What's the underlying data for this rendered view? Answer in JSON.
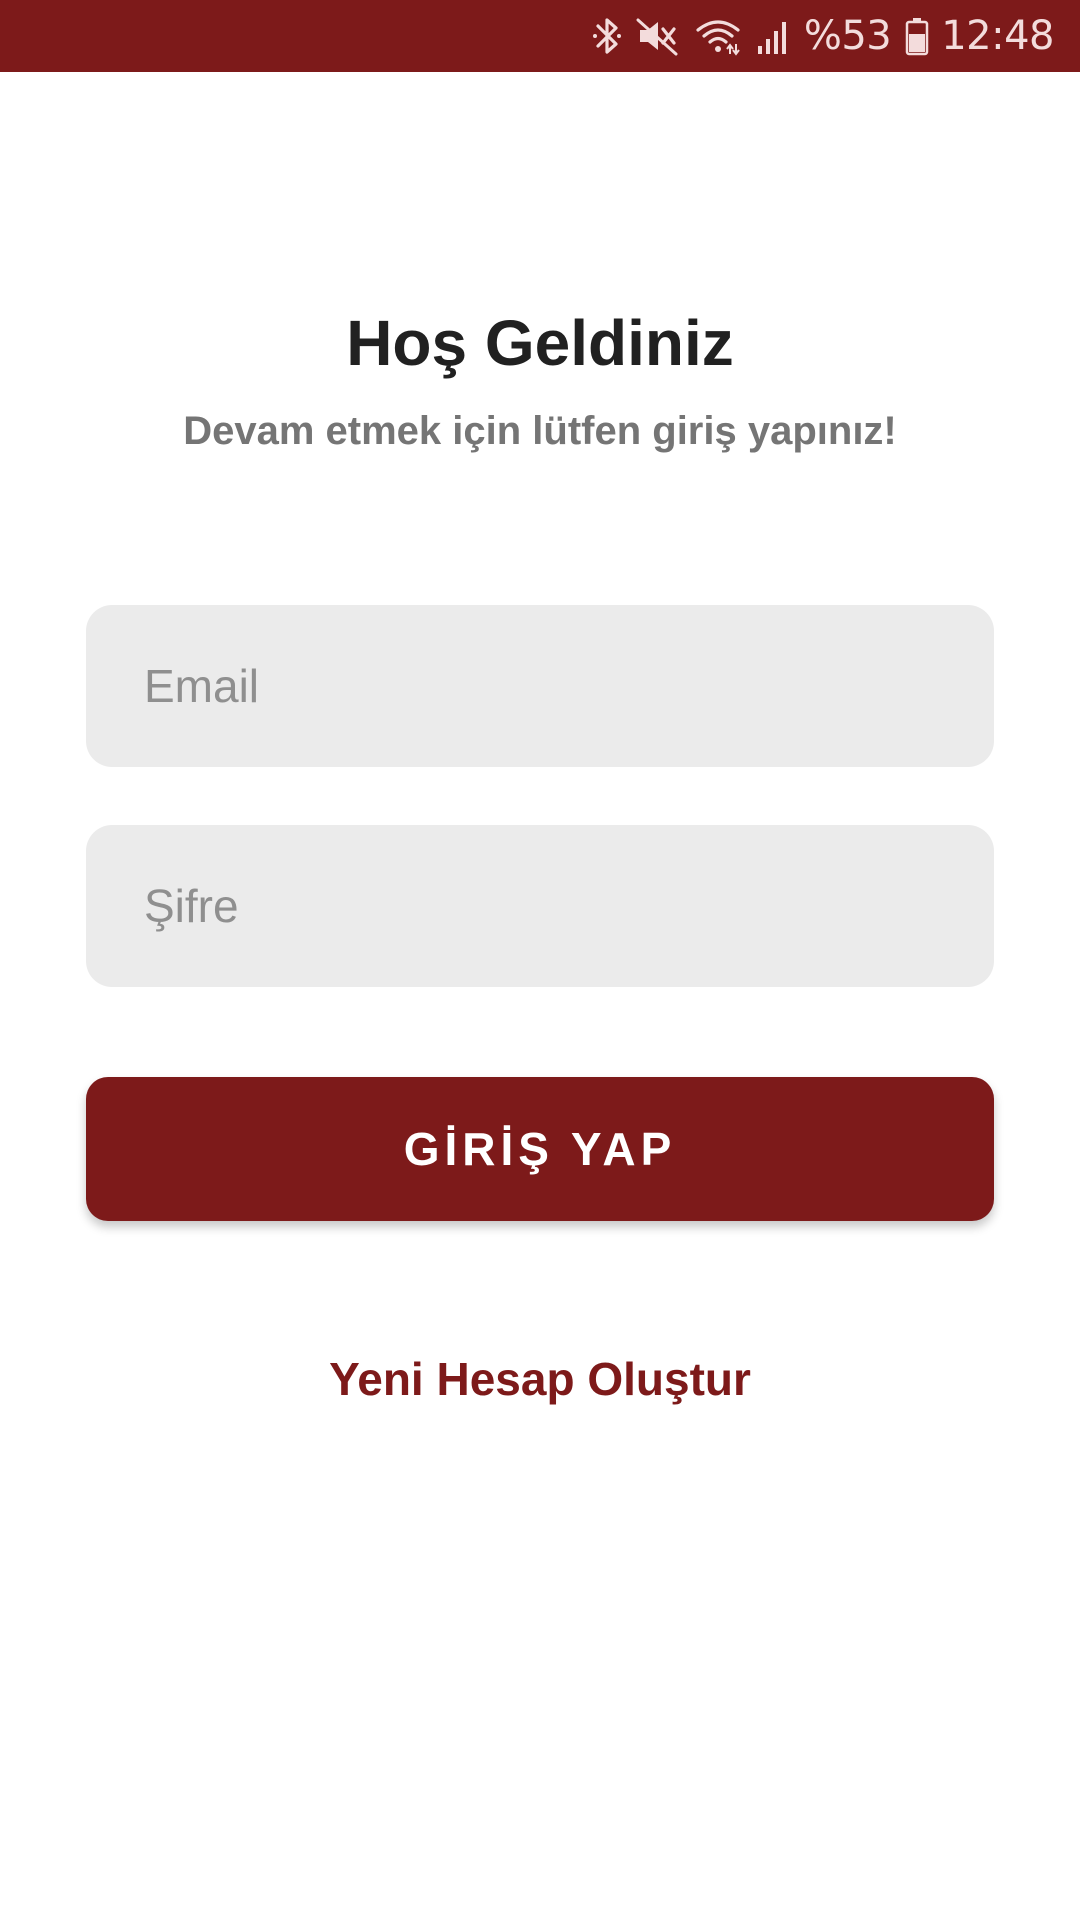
{
  "status_bar": {
    "background": "#7d1a1a",
    "icons": [
      "bluetooth-icon",
      "mute-icon",
      "wifi-icon",
      "signal-icon",
      "battery-icon"
    ],
    "battery": "%53",
    "time": "12:48"
  },
  "header": {
    "title": "Hoş Geldiniz",
    "subtitle": "Devam etmek için lütfen giriş yapınız!"
  },
  "form": {
    "email_placeholder": "Email",
    "email_value": "",
    "password_placeholder": "Şifre",
    "password_value": "",
    "login_label": "GİRİŞ YAP"
  },
  "footer": {
    "signup_label": "Yeni Hesap Oluştur"
  },
  "colors": {
    "primary": "#7d1a1a",
    "field_bg": "#ebebeb",
    "title": "#212121",
    "subtitle": "#757575"
  }
}
